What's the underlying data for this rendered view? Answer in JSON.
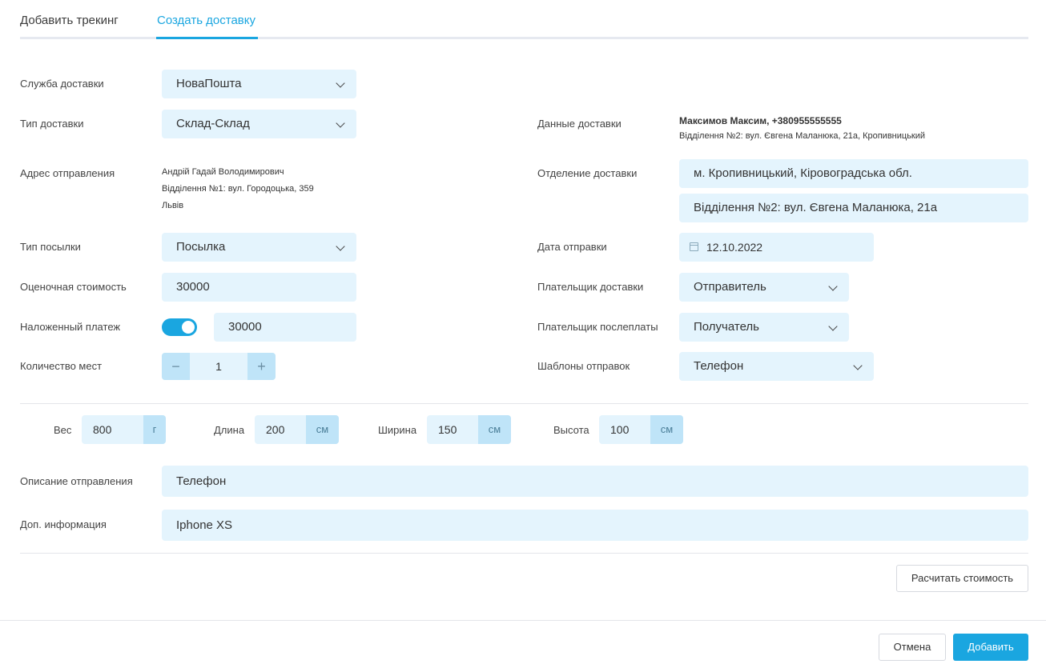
{
  "tabs": [
    "Добавить трекинг",
    "Создать доставку"
  ],
  "left": {
    "service_label": "Служба доставки",
    "service_value": "НоваПошта",
    "delivery_type_label": "Тип доставки",
    "delivery_type_value": "Склад-Склад",
    "sender_address_label": "Адрес отправления",
    "sender_name": "Андрій Гадай Володимирович",
    "sender_branch": "Відділення №1: вул. Городоцька, 359",
    "sender_city": "Львів",
    "parcel_type_label": "Тип посылки",
    "parcel_type_value": "Посылка",
    "declared_value_label": "Оценочная стоимость",
    "declared_value": "30000",
    "cod_label": "Наложенный платеж",
    "cod_enabled": true,
    "cod_value": "30000",
    "places_label": "Количество мест",
    "places_value": "1",
    "minus": "−",
    "plus": "+"
  },
  "right": {
    "delivery_data_label": "Данные доставки",
    "recipient": "Максимов Максим, +380955555555",
    "recipient_branch": "Відділення №2: вул. Євгена Маланюка, 21а, Кропивницький",
    "branch_label": "Отделение доставки",
    "city_value": "м. Кропивницький, Кіровоградська обл.",
    "branch_value": "Відділення №2: вул. Євгена Маланюка, 21а",
    "ship_date_label": "Дата отправки",
    "ship_date_value": "12.10.2022",
    "delivery_payer_label": "Плательщик доставки",
    "delivery_payer_value": "Отправитель",
    "cod_payer_label": "Плательщик послеплаты",
    "cod_payer_value": "Получатель",
    "templates_label": "Шаблоны отправок",
    "templates_value": "Телефон"
  },
  "dimensions": [
    {
      "label": "Вес",
      "value": "800",
      "unit": "г"
    },
    {
      "label": "Длина",
      "value": "200",
      "unit": "см"
    },
    {
      "label": "Ширина",
      "value": "150",
      "unit": "см"
    },
    {
      "label": "Высота",
      "value": "100",
      "unit": "см"
    }
  ],
  "description_label": "Описание отправления",
  "description_value": "Телефон",
  "extra_label": "Доп. информация",
  "extra_value": "Iphone XS",
  "buttons": {
    "calculate": "Расчитать стоимость",
    "cancel": "Отмена",
    "add": "Добавить"
  },
  "colors": {
    "accent": "#1aa6e0",
    "field_bg": "#e4f4fd",
    "unit_bg": "#bfe4f8"
  }
}
